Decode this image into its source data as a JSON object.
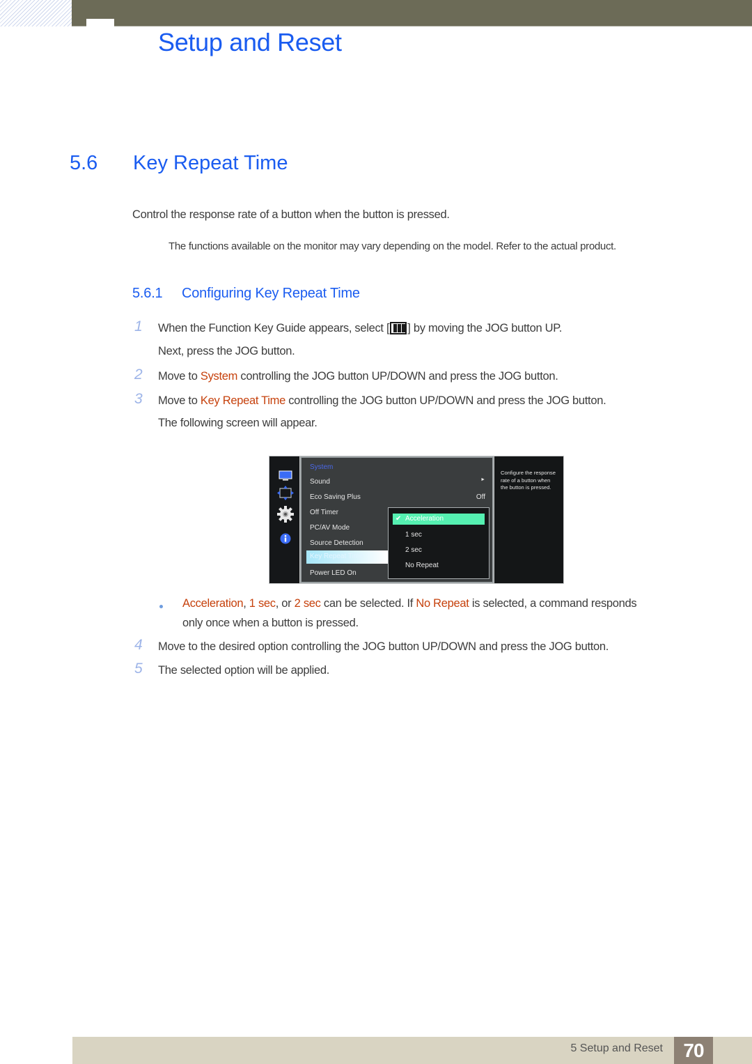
{
  "header": {
    "chapter_title": "Setup and Reset",
    "colors": {
      "bar": "#6c6b57",
      "accent": "#1a5cf0"
    }
  },
  "section": {
    "number": "5.6",
    "title": "Key Repeat Time",
    "intro": "Control the response rate of a button when the button is pressed.",
    "note": "The functions available on the monitor may vary depending on the model. Refer to the actual product."
  },
  "subsection": {
    "number": "5.6.1",
    "title": "Configuring Key Repeat Time"
  },
  "steps": [
    {
      "num": "1",
      "line1_before": "When the Function Key Guide appears, select [",
      "icon": "jog-menu-icon",
      "line1_after": "] by moving the JOG button UP.",
      "line2": "Next, press the JOG button."
    },
    {
      "num": "2",
      "before": "Move to ",
      "highlight": "System",
      "after": " controlling the JOG button UP/DOWN and press the JOG button."
    },
    {
      "num": "3",
      "before": "Move to ",
      "highlight": "Key Repeat Time",
      "after": " controlling the JOG button UP/DOWN and press the JOG button.",
      "line2": "The following screen will appear."
    },
    {
      "num": "4",
      "text": "Move to the desired option controlling the JOG button UP/DOWN and press the JOG button."
    },
    {
      "num": "5",
      "text": "The selected option will be applied."
    }
  ],
  "bullet": {
    "opt1": "Acceleration",
    "sep1": ", ",
    "opt2": "1 sec",
    "sep2": ", or ",
    "opt3": "2 sec",
    "mid": " can be selected. If ",
    "opt4": "No Repeat",
    "end": " is selected, a command responds",
    "line2": "only once when a button is pressed."
  },
  "osd": {
    "sidebar_icons": [
      "picture-icon",
      "position-icon",
      "system-gear-icon",
      "information-icon"
    ],
    "menu_title": "System",
    "items": [
      {
        "label": "Sound",
        "value": "►"
      },
      {
        "label": "Eco Saving Plus",
        "value": "Off"
      },
      {
        "label": "Off Timer",
        "value": ""
      },
      {
        "label": "PC/AV Mode",
        "value": ""
      },
      {
        "label": "Source Detection",
        "value": ""
      },
      {
        "label": "Key Repeat Time",
        "value": "",
        "selected": true
      },
      {
        "label": "Power LED On",
        "value": ""
      }
    ],
    "popup_options": [
      {
        "label": "Acceleration",
        "selected": true
      },
      {
        "label": "1 sec"
      },
      {
        "label": "2 sec"
      },
      {
        "label": "No Repeat"
      }
    ],
    "check_mark": "✔",
    "help_text": "Configure the response rate of a button when the button is pressed."
  },
  "footer": {
    "label": "5 Setup and Reset",
    "page": "70"
  }
}
